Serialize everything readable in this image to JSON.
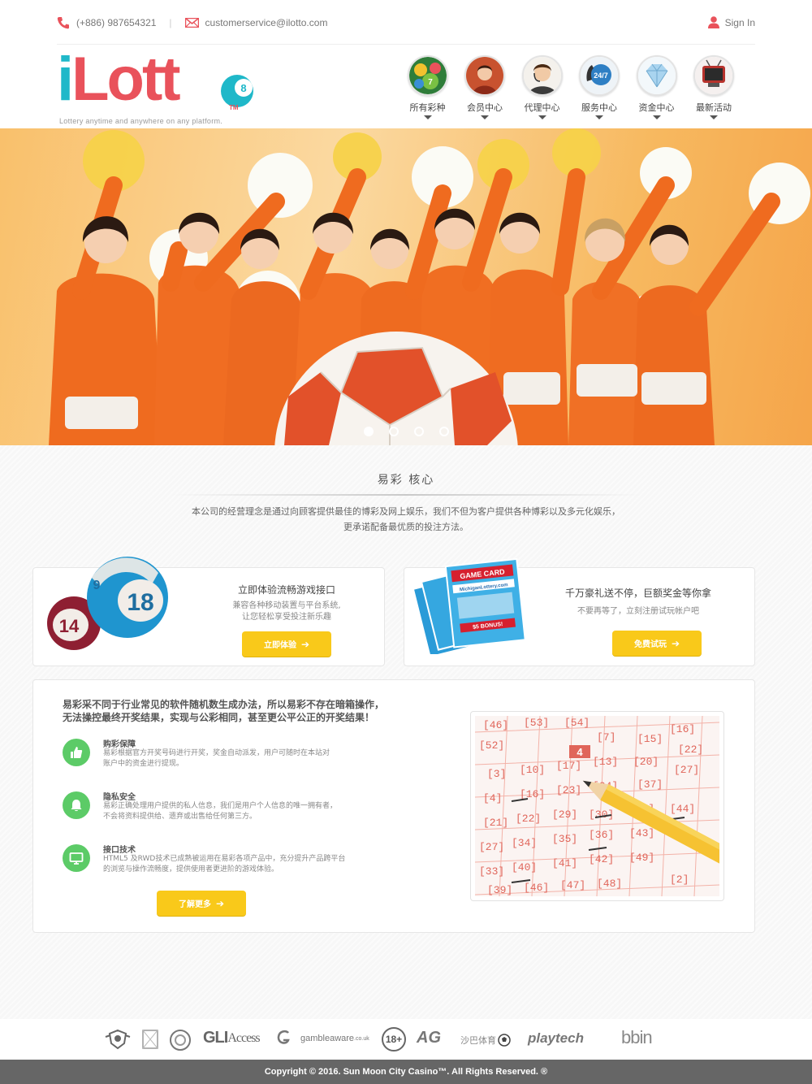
{
  "topbar": {
    "phone": "(+886) 987654321",
    "separator": "|",
    "email": "customerservice@ilotto.com",
    "signin": "Sign In"
  },
  "logo": {
    "text_i": "i",
    "text_rest": "Lott",
    "tm": "TM",
    "tagline": "Lottery anytime and anywhere on any platform."
  },
  "nav": [
    {
      "label": "所有彩种",
      "icon": "lottery-ball-icon"
    },
    {
      "label": "会员中心",
      "icon": "member-icon"
    },
    {
      "label": "代理中心",
      "icon": "agent-icon"
    },
    {
      "label": "服务中心",
      "icon": "support-247-icon"
    },
    {
      "label": "资金中心",
      "icon": "diamond-icon"
    },
    {
      "label": "最新活动",
      "icon": "tv-icon"
    }
  ],
  "hero": {
    "slides": 4,
    "active_slide": 1
  },
  "core": {
    "title": "易彩 核心",
    "desc_line1": "本公司的经营理念是通过向顾客提供最佳的博彩及网上娱乐，我们不但为客户提供各种博彩以及多元化娱乐，",
    "desc_line2": "更承诺配备最优质的投注方法。"
  },
  "card1": {
    "title": "立即体验流畅游戏接口",
    "text1": "兼容各种移动装置与平台系统,",
    "text2": "让您轻松享受投注新乐趣",
    "button": "立即体验",
    "ball_a": "18",
    "ball_b": "14",
    "ball_c": "9"
  },
  "card2": {
    "title": "千万豪礼送不停，巨额奖金等你拿",
    "text": "不要再等了，立刻注册试玩帐户吧",
    "button": "免费试玩",
    "ticket_brand": "GAME CARD",
    "ticket_site": "MichiganLottery.com",
    "ticket_bonus": "$5 BONUS!"
  },
  "card3": {
    "lead_line1": "易彩采不同于行业常见的软件随机数生成办法，所以易彩不存在暗箱操作，",
    "lead_line2": "无法操控最终开奖结果，实现与公彩相同，甚至更公平公正的开奖结果！",
    "features": [
      {
        "title": "购彩保障",
        "line1": "易彩根据官方开奖号码进行开奖，奖金自动派发，用户可随时在本站对",
        "line2": "账户中的资金进行提现。",
        "icon": "thumbs-up-icon"
      },
      {
        "title": "隐私安全",
        "line1": "易彩正确处理用户提供的私人信息，我们是用户个人信息的唯一拥有者，",
        "line2": "不会将资料提供给、遗弃或出售给任何第三方。",
        "icon": "bell-icon"
      },
      {
        "title": "接口技术",
        "line1": "HTML5 及RWD技术已成熟被运用在易彩各项产品中，充分提升产品跨平台",
        "line2": "的浏览与操作流畅度，提供使用者更进阶的游戏体验。",
        "icon": "monitor-icon"
      }
    ],
    "button": "了解更多"
  },
  "partners": {
    "gli": "GLI",
    "access": "Access",
    "gambleaware": "gambleaware",
    "gambleaware_suffix": ".co.uk",
    "age": "18+",
    "ag": "AG",
    "shaba": "沙巴体育",
    "playtech": "playtech",
    "bbin": "bbin"
  },
  "footer": {
    "copyright": "Copyright © 2016. Sun Moon City Casino™. All Rights Reserved. ®"
  },
  "colors": {
    "brand_cyan": "#1fb8c9",
    "brand_red": "#e9525b",
    "button_yellow": "#f9c91a",
    "feature_green": "#5ccb67",
    "footer_gray": "#666666"
  }
}
